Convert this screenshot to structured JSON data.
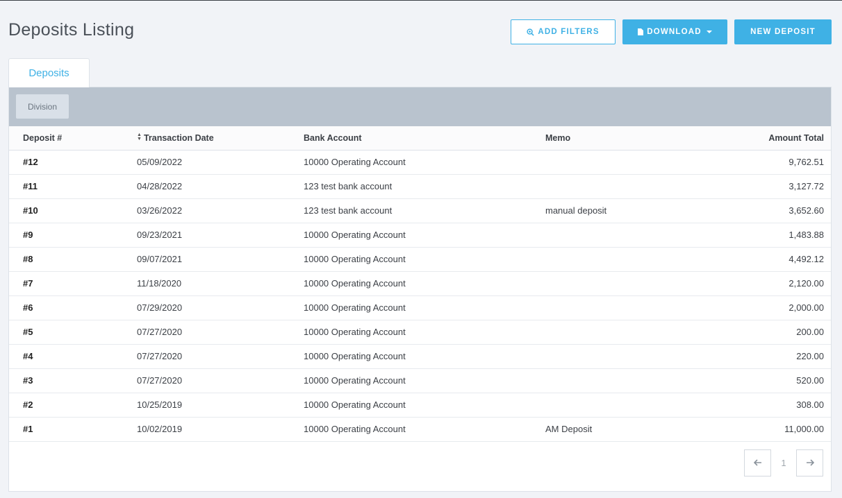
{
  "page": {
    "title": "Deposits Listing"
  },
  "actions": {
    "add_filters": "ADD FILTERS",
    "download": "DOWNLOAD",
    "new_deposit": "NEW DEPOSIT"
  },
  "tabs": {
    "deposits": "Deposits"
  },
  "filters": {
    "division": "Division"
  },
  "columns": {
    "deposit": "Deposit #",
    "date": "Transaction Date",
    "bank": "Bank Account",
    "memo": "Memo",
    "amount": "Amount Total"
  },
  "rows": [
    {
      "deposit": "#12",
      "date": "05/09/2022",
      "bank": "10000 Operating Account",
      "memo": "",
      "amount": "9,762.51"
    },
    {
      "deposit": "#11",
      "date": "04/28/2022",
      "bank": "123 test bank account",
      "memo": "",
      "amount": "3,127.72"
    },
    {
      "deposit": "#10",
      "date": "03/26/2022",
      "bank": "123 test bank account",
      "memo": "manual deposit",
      "amount": "3,652.60"
    },
    {
      "deposit": "#9",
      "date": "09/23/2021",
      "bank": "10000 Operating Account",
      "memo": "",
      "amount": "1,483.88"
    },
    {
      "deposit": "#8",
      "date": "09/07/2021",
      "bank": "10000 Operating Account",
      "memo": "",
      "amount": "4,492.12"
    },
    {
      "deposit": "#7",
      "date": "11/18/2020",
      "bank": "10000 Operating Account",
      "memo": "",
      "amount": "2,120.00"
    },
    {
      "deposit": "#6",
      "date": "07/29/2020",
      "bank": "10000 Operating Account",
      "memo": "",
      "amount": "2,000.00"
    },
    {
      "deposit": "#5",
      "date": "07/27/2020",
      "bank": "10000 Operating Account",
      "memo": "",
      "amount": "200.00"
    },
    {
      "deposit": "#4",
      "date": "07/27/2020",
      "bank": "10000 Operating Account",
      "memo": "",
      "amount": "220.00"
    },
    {
      "deposit": "#3",
      "date": "07/27/2020",
      "bank": "10000 Operating Account",
      "memo": "",
      "amount": "520.00"
    },
    {
      "deposit": "#2",
      "date": "10/25/2019",
      "bank": "10000 Operating Account",
      "memo": "",
      "amount": "308.00"
    },
    {
      "deposit": "#1",
      "date": "10/02/2019",
      "bank": "10000 Operating Account",
      "memo": "AM Deposit",
      "amount": "11,000.00"
    }
  ],
  "pagination": {
    "current_page": "1"
  }
}
